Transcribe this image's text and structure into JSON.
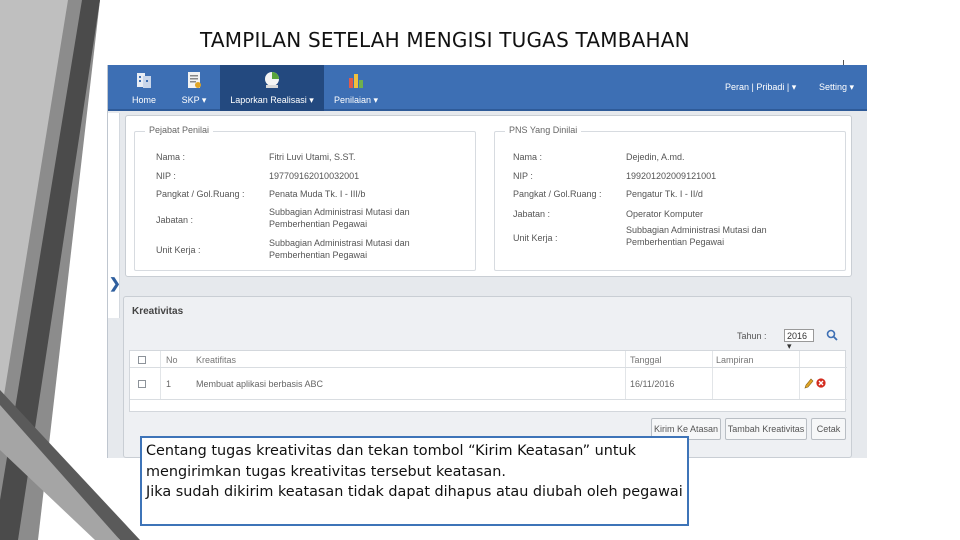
{
  "slide": {
    "title": "TAMPILAN SETELAH MENGISI TUGAS TAMBAHAN"
  },
  "navbar": {
    "items": [
      {
        "label": "Home",
        "icon": "home-icon"
      },
      {
        "label": "SKP ▾",
        "icon": "document-icon"
      },
      {
        "label": "Laporkan Realisasi ▾",
        "icon": "report-icon"
      },
      {
        "label": "Penilaian ▾",
        "icon": "bar-chart-icon"
      }
    ],
    "right_menu": "Peran | Pribadi | ▾",
    "setting": "Setting ▾"
  },
  "pejabat": {
    "legend": "Pejabat Penilai",
    "fields": [
      {
        "label": "Nama :",
        "value": "Fitri Luvi Utami, S.ST."
      },
      {
        "label": "NIP :",
        "value": "197709162010032001"
      },
      {
        "label": "Pangkat / Gol.Ruang :",
        "value": "Penata Muda Tk. I - III/b"
      },
      {
        "label": "Jabatan :",
        "value": "Subbagian Administrasi Mutasi dan Pemberhentian Pegawai"
      },
      {
        "label": "Unit Kerja :",
        "value": "Subbagian Administrasi Mutasi dan Pemberhentian Pegawai"
      }
    ]
  },
  "pns": {
    "legend": "PNS Yang Dinilai",
    "fields": [
      {
        "label": "Nama :",
        "value": "Dejedin, A.md."
      },
      {
        "label": "NIP :",
        "value": "199201202009121001"
      },
      {
        "label": "Pangkat / Gol.Ruang :",
        "value": "Pengatur Tk. I - II/d"
      },
      {
        "label": "Jabatan :",
        "value": "Operator Komputer"
      },
      {
        "label": "Unit Kerja :",
        "value": "Subbagian Administrasi Mutasi dan Pemberhentian Pegawai"
      }
    ]
  },
  "kreativitas": {
    "title": "Kreativitas",
    "tahun_label": "Tahun :",
    "tahun_value": "2016 ▾",
    "columns": [
      "No",
      "Kreatifitas",
      "Tanggal",
      "Lampiran"
    ],
    "rows": [
      {
        "no": "1",
        "kreatifitas": "Membuat aplikasi berbasis ABC",
        "tanggal": "16/11/2016",
        "lampiran": ""
      }
    ],
    "buttons": {
      "kirim": "Kirim Ke Atasan",
      "tambah": "Tambah Kreativitas",
      "cetak": "Cetak"
    }
  },
  "caption": {
    "line1": "Centang tugas kreativitas  dan tekan tombol “Kirim Keatasan” untuk mengirimkan tugas kreativitas tersebut keatasan.",
    "line2": "Jika sudah dikirim keatasan tidak dapat dihapus atau diubah oleh pegawai"
  },
  "colors": {
    "navbar": "#3d6fb4",
    "navbar_active": "#23497f",
    "caption_border": "#3e74b8",
    "slide_edge_dark": "#4a4a4a",
    "slide_edge_light": "#9a9a9a"
  }
}
